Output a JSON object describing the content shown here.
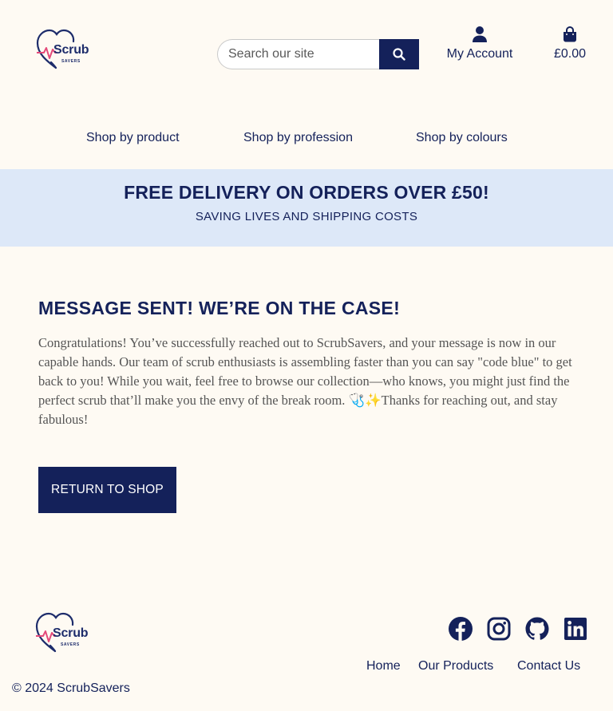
{
  "header": {
    "logo": {
      "word": "Scrub",
      "sub": "SAVERS"
    },
    "search": {
      "placeholder": "Search our site",
      "icon": "search-icon"
    },
    "account": {
      "label": "My Account",
      "icon": "user-icon"
    },
    "cart": {
      "label": "£0.00",
      "icon": "shopping-bag-icon"
    }
  },
  "nav": {
    "items": [
      {
        "label": "Shop by product"
      },
      {
        "label": "Shop by profession"
      },
      {
        "label": "Shop by colours"
      }
    ]
  },
  "banner": {
    "title": "FREE DELIVERY ON ORDERS OVER £50!",
    "subtitle": "SAVING LIVES AND SHIPPING COSTS"
  },
  "main": {
    "title": "MESSAGE SENT! WE’RE ON THE CASE!",
    "body": "Congratulations! You’ve successfully reached out to ScrubSavers, and your message is now in our capable hands. Our team of scrub enthusiasts is assembling faster than you can say \"code blue\" to get back to you! While you wait, feel free to browse our collection—who knows, you might just find the perfect scrub that’ll make you the envy of the break room. 🩺✨Thanks for reaching out, and stay fabulous!",
    "button": "RETURN TO SHOP"
  },
  "footer": {
    "logo": {
      "word": "Scrub",
      "sub": "SAVERS"
    },
    "social": [
      "facebook-icon",
      "instagram-icon",
      "github-icon",
      "linkedin-icon"
    ],
    "links": [
      {
        "label": "Home"
      },
      {
        "label": "Our Products"
      },
      {
        "label": "Contact Us"
      }
    ],
    "copyright": "© 2024 ScrubSavers"
  },
  "colors": {
    "background": "#fefaf3",
    "navy": "#14215a",
    "banner": "#dde8f8",
    "body_text": "#555555"
  }
}
